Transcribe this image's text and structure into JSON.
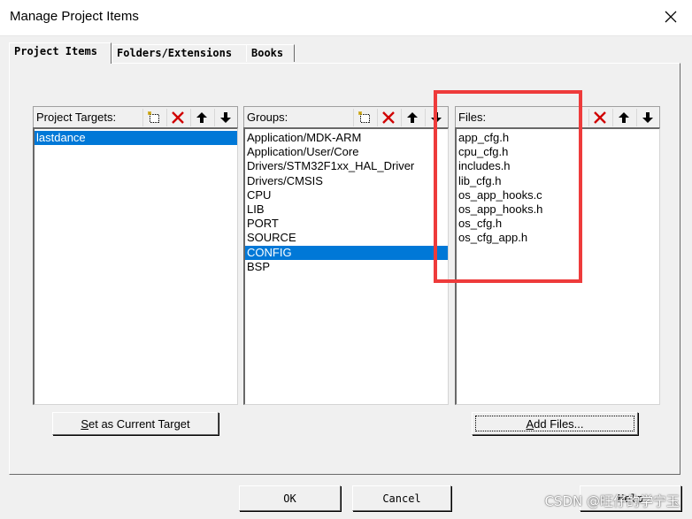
{
  "window": {
    "title": "Manage Project Items"
  },
  "tabs": [
    {
      "label": "Project Items",
      "active": true
    },
    {
      "label": "Folders/Extensions",
      "active": false
    },
    {
      "label": "Books",
      "active": false
    }
  ],
  "targets": {
    "label": "Project Targets:",
    "items": [
      "lastdance"
    ],
    "selected_index": 0
  },
  "groups": {
    "label": "Groups:",
    "items": [
      "Application/MDK-ARM",
      "Application/User/Core",
      "Drivers/STM32F1xx_HAL_Driver",
      "Drivers/CMSIS",
      "CPU",
      "LIB",
      "PORT",
      "SOURCE",
      "CONFIG",
      "BSP"
    ],
    "selected_index": 8
  },
  "files": {
    "label": "Files:",
    "items": [
      "app_cfg.h",
      "cpu_cfg.h",
      "includes.h",
      "lib_cfg.h",
      "os_app_hooks.c",
      "os_app_hooks.h",
      "os_cfg.h",
      "os_cfg_app.h"
    ]
  },
  "buttons": {
    "set_target_accel": "S",
    "set_target_rest": "et as Current Target",
    "add_files_accel": "A",
    "add_files_rest": "dd Files...",
    "ok": "OK",
    "cancel": "Cancel",
    "help": "Help"
  },
  "watermark": "CSDN @旺仔的学宁玉",
  "colors": {
    "selection": "#0078d7",
    "highlight_box": "#ee3b3b",
    "delete_icon": "#d00000"
  }
}
